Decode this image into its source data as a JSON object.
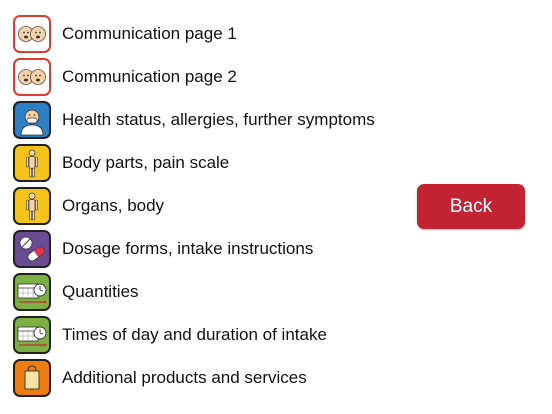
{
  "menu": {
    "items": [
      {
        "label": "Communication page 1",
        "icon": "two-faces-icon",
        "frame": "#e03a2e",
        "bg": "#ffffff"
      },
      {
        "label": "Communication page 2",
        "icon": "two-faces-icon",
        "frame": "#e03a2e",
        "bg": "#ffffff"
      },
      {
        "label": "Health status, allergies, further symptoms",
        "icon": "sick-person-icon",
        "frame": "#222222",
        "bg": "#2f7fc4"
      },
      {
        "label": "Body parts, pain scale",
        "icon": "body-figure-icon",
        "frame": "#222222",
        "bg": "#f4c41a"
      },
      {
        "label": "Organs, body",
        "icon": "body-figure-icon",
        "frame": "#222222",
        "bg": "#f4c41a"
      },
      {
        "label": "Dosage forms, intake instructions",
        "icon": "pills-icon",
        "frame": "#222222",
        "bg": "#6a4c93"
      },
      {
        "label": "Quantities",
        "icon": "calendar-clock-icon",
        "frame": "#222222",
        "bg": "#7db043"
      },
      {
        "label": "Times of day and duration of intake",
        "icon": "calendar-clock-icon",
        "frame": "#222222",
        "bg": "#7db043"
      },
      {
        "label": "Additional products and services",
        "icon": "shopping-bag-icon",
        "frame": "#222222",
        "bg": "#ee7d12"
      }
    ]
  },
  "back_button": {
    "label": "Back",
    "color": "#c42334"
  }
}
